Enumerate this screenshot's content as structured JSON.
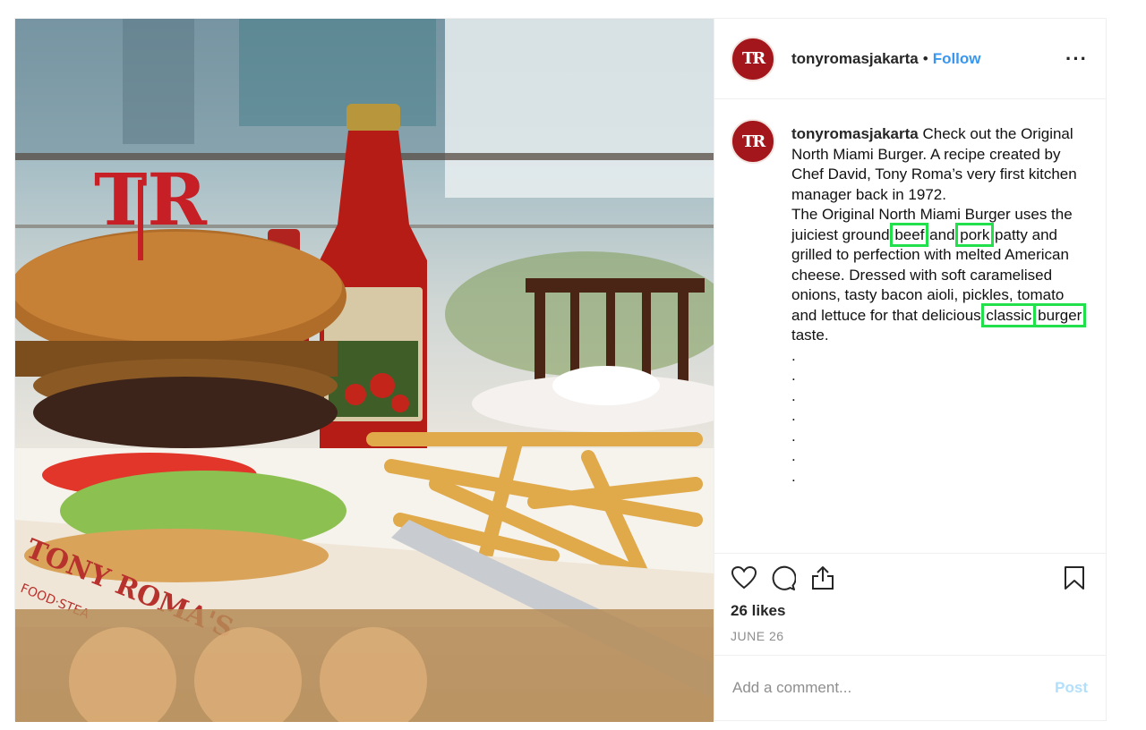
{
  "header": {
    "avatar_text": "TR",
    "username": "tonyromasjakarta",
    "separator": "•",
    "follow_label": "Follow",
    "more_label": "···"
  },
  "photo": {
    "logo_text": "TR",
    "placemat_text": "TONY ROMA'S",
    "placemat_subtext": "FOOD·STEA"
  },
  "caption": {
    "username": "tonyromasjakarta",
    "para1": " Check out the Original North Miami Burger. A recipe created by Chef David, Tony Roma’s very first kitchen manager back in 1972.",
    "para2_a": "The Original North Miami Burger uses the juiciest ground ",
    "hl_beef": "beef",
    "para2_b": " and ",
    "hl_pork": "pork",
    "para2_c": " patty and grilled to perfection with melted American cheese. Dressed with soft caramelised onions, tasty bacon aioli, pickles, tomato and lettuce for that delicious ",
    "hl_classic": "classic",
    "para2_d": " ",
    "hl_burger": "burger",
    "para2_e": " taste.",
    "dots": [
      ".",
      ".",
      ".",
      ".",
      ".",
      ".",
      "."
    ]
  },
  "actions": {
    "likes": "26 likes",
    "date": "JUNE 26"
  },
  "comment": {
    "placeholder": "Add a comment...",
    "post_label": "Post"
  },
  "colors": {
    "highlight": "#22e04b",
    "follow": "#3897f0",
    "post_disabled": "#b2dffc",
    "brand_red": "#a3161b"
  },
  "icons": [
    "heart-icon",
    "comment-icon",
    "share-icon",
    "bookmark-icon",
    "more-icon"
  ]
}
